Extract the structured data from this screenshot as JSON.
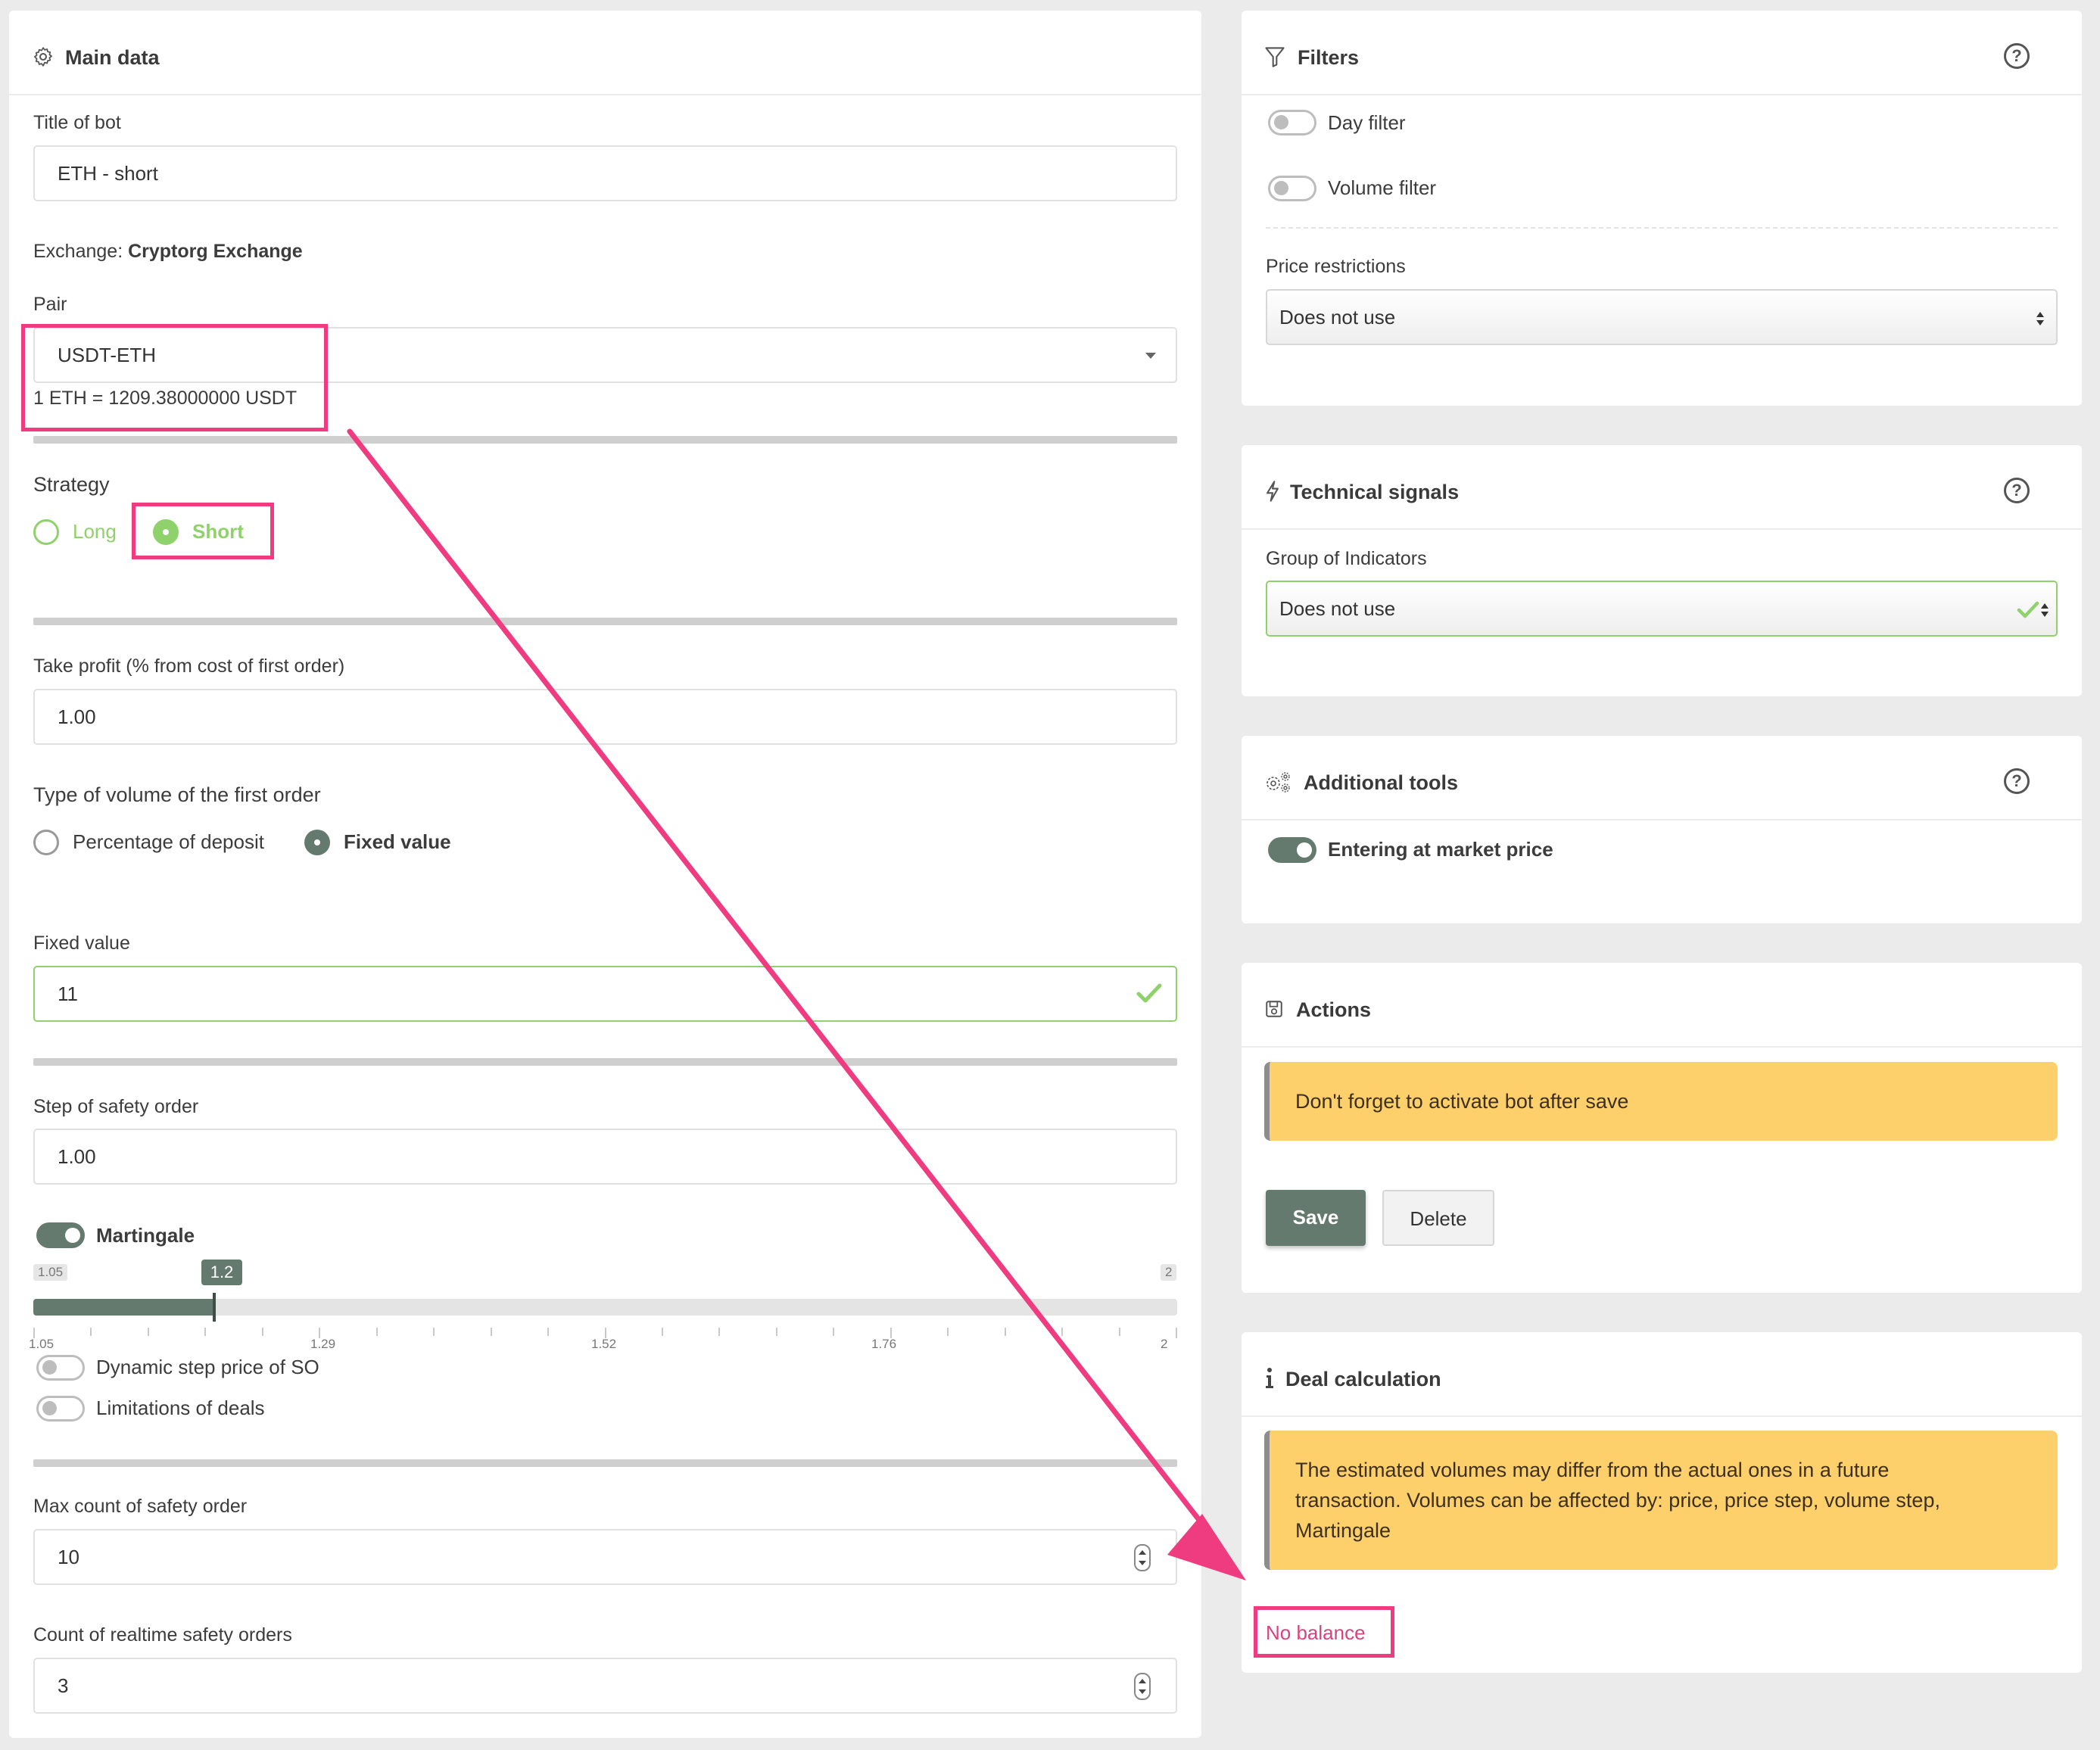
{
  "main": {
    "title": "Main data",
    "bot_title_label": "Title of bot",
    "bot_title_value": "ETH  - short",
    "exchange_label": "Exchange:",
    "exchange_value": "Cryptorg Exchange",
    "pair_label": "Pair",
    "pair_value": "USDT-ETH",
    "rate_text": "1 ETH = 1209.38000000 USDT",
    "strategy_label": "Strategy",
    "strategy_long": "Long",
    "strategy_short": "Short",
    "take_profit_label": "Take profit (% from cost of first order)",
    "take_profit_value": "1.00",
    "volume_type_label": "Type of volume of the first order",
    "volume_type_percentage": "Percentage of deposit",
    "volume_type_fixed": "Fixed value",
    "fixed_value_label": "Fixed value",
    "fixed_value_value": "11",
    "step_label": "Step of safety order",
    "step_value": "1.00",
    "martingale_label": "Martingale",
    "martingale_enabled": true,
    "slider": {
      "min_label": "1.05",
      "max_label": "2",
      "value_label": "1.2",
      "min": 1.05,
      "max": 2,
      "value": 1.2,
      "ticks": [
        "1.05",
        "1.29",
        "1.52",
        "1.76",
        "2"
      ]
    },
    "dynamic_step_label": "Dynamic step price of SO",
    "limitations_label": "Limitations of deals",
    "max_so_label": "Max count of safety order",
    "max_so_value": "10",
    "realtime_so_label": "Count of realtime safety orders",
    "realtime_so_value": "3"
  },
  "filters": {
    "title": "Filters",
    "day_filter": "Day filter",
    "volume_filter": "Volume filter",
    "price_restrictions_label": "Price restrictions",
    "price_restrictions_value": "Does not use"
  },
  "signals": {
    "title": "Technical signals",
    "group_label": "Group of Indicators",
    "group_value": "Does not use"
  },
  "tools": {
    "title": "Additional tools",
    "market_price_label": "Entering at market price",
    "market_price_enabled": true
  },
  "actions": {
    "title": "Actions",
    "alert": "Don't forget to activate bot after save",
    "save": "Save",
    "delete": "Delete"
  },
  "deal": {
    "title": "Deal calculation",
    "alert_line1": "The estimated volumes may differ from the actual ones in a future",
    "alert_line2": "transaction. Volumes can be affected by: price, price step, volume step,",
    "alert_line3": "Martingale",
    "no_balance": "No balance"
  },
  "colors": {
    "accent_green": "#8fd16a",
    "toggle_on": "#647a6e",
    "highlight_pink": "#ef3b7f",
    "alert_yellow": "#fdd06b",
    "no_balance_text": "#d6447e"
  }
}
